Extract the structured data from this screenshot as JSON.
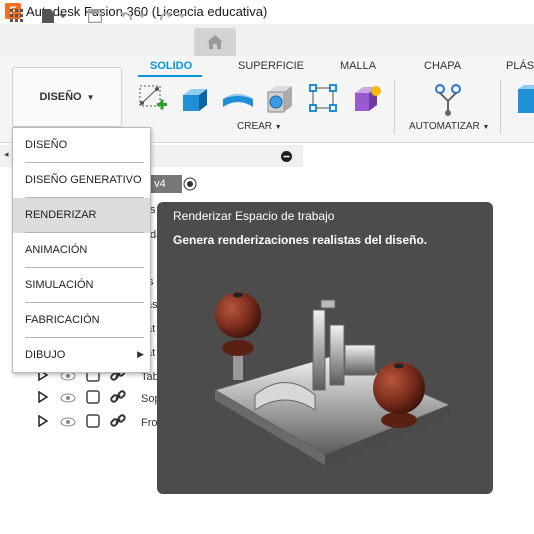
{
  "app": {
    "logo_letter": "F",
    "title": "Autodesk Fusion 360 (Licencia educativa)"
  },
  "toolbar": {
    "icons": [
      "grid-icon",
      "file-icon",
      "save-icon",
      "undo-icon",
      "redo-icon",
      "home-icon"
    ]
  },
  "ribbon": {
    "workspace_label": "DISEÑO",
    "tabs": [
      "SOLIDO",
      "SUPERFICIE",
      "MALLA",
      "CHAPA",
      "PLÁS"
    ],
    "groups": {
      "crear": "CREAR",
      "automatizar": "AUTOMATIZAR"
    }
  },
  "browser": {
    "version_fragment": "e v4",
    "rows": [
      {
        "label": "Tab"
      },
      {
        "label": "Sop"
      },
      {
        "label": "Fro"
      }
    ],
    "partial_letters": [
      "s",
      "as",
      "at",
      "at"
    ]
  },
  "workspace_menu": {
    "items": [
      {
        "label": "DISEÑO"
      },
      {
        "label": "DISEÑO GENERATIVO"
      },
      {
        "label": "RENDERIZAR"
      },
      {
        "label": "ANIMACIÓN"
      },
      {
        "label": "SIMULACIÓN"
      },
      {
        "label": "FABRICACIÓN"
      },
      {
        "label": "DIBUJO"
      }
    ],
    "selected_index": 2
  },
  "tooltip": {
    "title": "Renderizar Espacio de trabajo",
    "description": "Genera renderizaciones realistas del diseño."
  },
  "colors": {
    "accent": "#0696d7",
    "tooltip_bg": "#4c4c4c",
    "logo": "#f37021"
  }
}
